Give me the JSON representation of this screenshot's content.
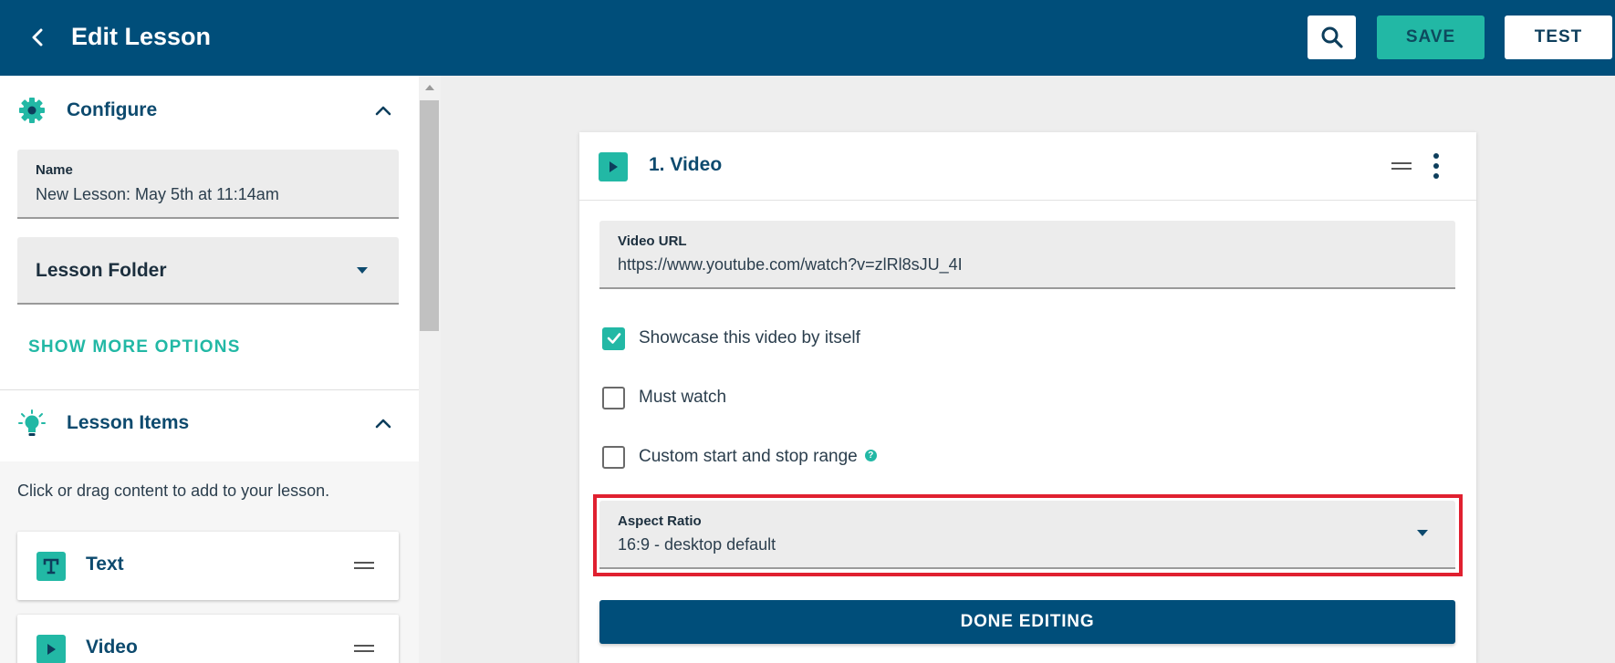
{
  "header": {
    "title": "Edit Lesson",
    "save_label": "SAVE",
    "test_label": "TEST"
  },
  "sidebar": {
    "configure": {
      "title": "Configure",
      "name_label": "Name",
      "name_value": "New Lesson: May 5th at 11:14am",
      "folder_label": "Lesson Folder",
      "show_more": "SHOW MORE OPTIONS"
    },
    "lesson_items": {
      "title": "Lesson Items",
      "hint": "Click or drag content to add to your lesson.",
      "items": [
        {
          "label": "Text",
          "icon": "text-icon"
        },
        {
          "label": "Video",
          "icon": "play-icon"
        }
      ]
    }
  },
  "card": {
    "title": "1. Video",
    "video_url_label": "Video URL",
    "video_url_value": "https://www.youtube.com/watch?v=zlRl8sJU_4I",
    "checkboxes": [
      {
        "label": "Showcase this video by itself",
        "checked": true
      },
      {
        "label": "Must watch",
        "checked": false
      },
      {
        "label": "Custom start and stop range",
        "checked": false
      }
    ],
    "aspect_label": "Aspect Ratio",
    "aspect_value": "16:9 - desktop default",
    "done_label": "DONE EDITING"
  },
  "colors": {
    "header_bg": "#004e7a",
    "accent": "#22b8a5",
    "highlight": "#e02030"
  }
}
